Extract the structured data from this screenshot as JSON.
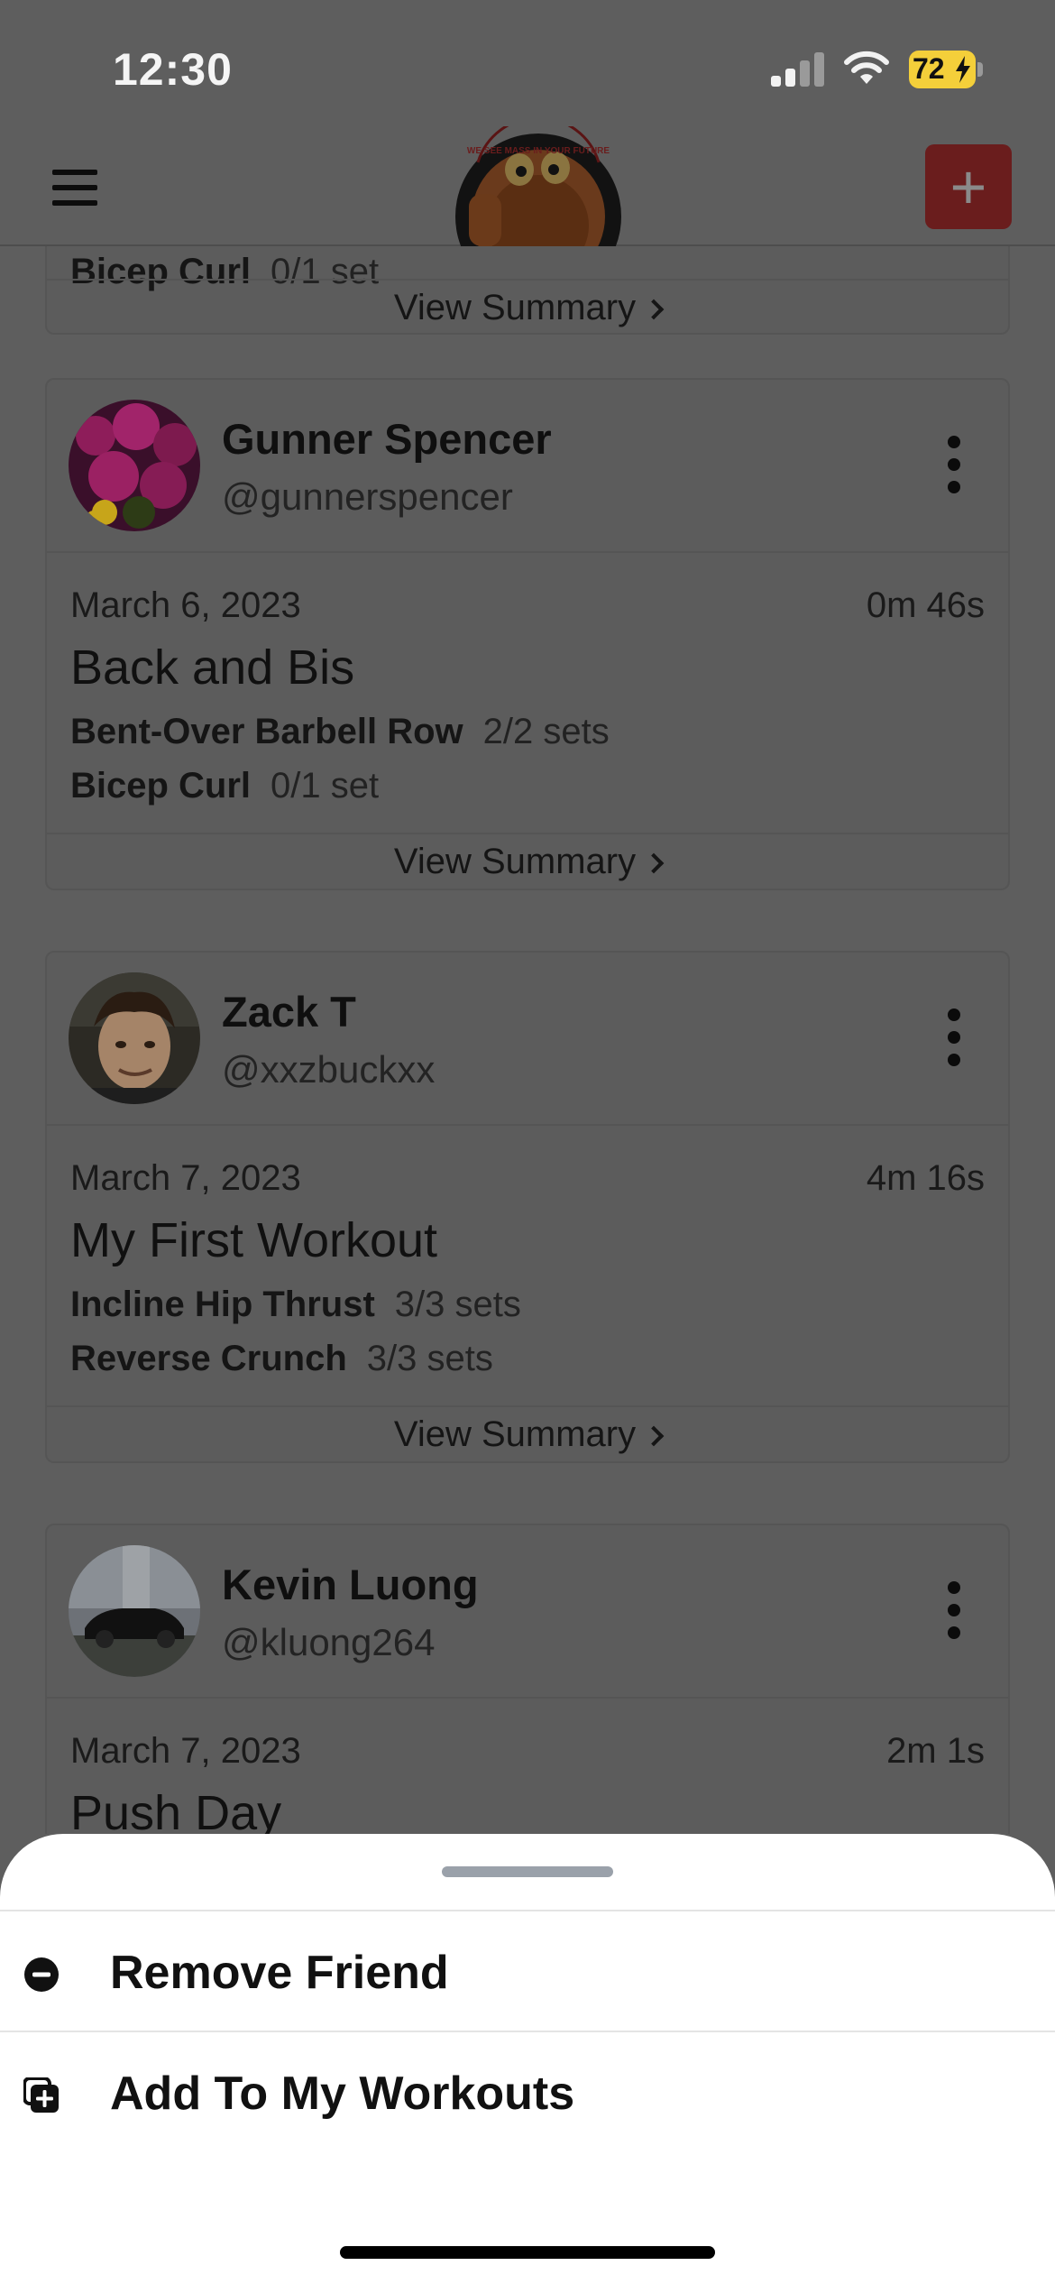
{
  "status_bar": {
    "time": "12:30",
    "battery": "72",
    "icons": [
      "cellular-signal-icon",
      "wifi-icon",
      "battery-charging-icon"
    ]
  },
  "nav": {
    "menu_icon": "hamburger-menu-icon",
    "logo_text": "WE SEE MASS IN YOUR FUTURE",
    "add_icon": "plus-icon"
  },
  "partial_card": {
    "exercise": {
      "name": "Bicep Curl",
      "sets": "0/1 set"
    },
    "view_summary": "View Summary"
  },
  "feed": [
    {
      "name": "Gunner Spencer",
      "handle": "@gunnerspencer",
      "date": "March 6, 2023",
      "duration": "0m 46s",
      "title": "Back and Bis",
      "exercises": [
        {
          "name": "Bent-Over Barbell Row",
          "sets": "2/2 sets"
        },
        {
          "name": "Bicep Curl",
          "sets": "0/1 set"
        }
      ],
      "view_summary": "View Summary"
    },
    {
      "name": "Zack T",
      "handle": "@xxzbuckxx",
      "date": "March 7, 2023",
      "duration": "4m 16s",
      "title": "My First Workout",
      "exercises": [
        {
          "name": "Incline Hip Thrust",
          "sets": "3/3 sets"
        },
        {
          "name": "Reverse Crunch",
          "sets": "3/3 sets"
        }
      ],
      "view_summary": "View Summary"
    },
    {
      "name": "Kevin Luong",
      "handle": "@kluong264",
      "date": "March 7, 2023",
      "duration": "2m 1s",
      "title": "Push Day"
    }
  ],
  "sheet": {
    "items": [
      {
        "label": "Remove Friend",
        "icon": "minus-circle-icon"
      },
      {
        "label": "Add To My Workouts",
        "icon": "add-to-collection-icon"
      }
    ]
  },
  "colors": {
    "overlay_bg": "#5e5e5e",
    "accent_red": "#6a1d1d",
    "battery_yellow": "#f4cf3a"
  }
}
